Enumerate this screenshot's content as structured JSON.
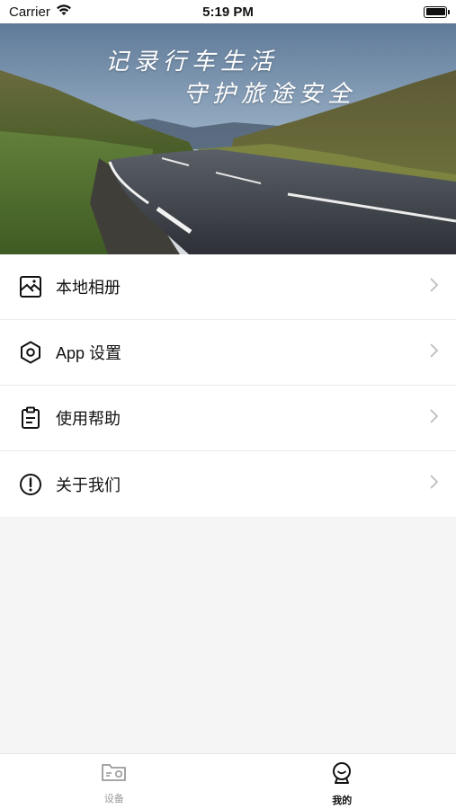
{
  "status_bar": {
    "carrier": "Carrier",
    "time": "5:19 PM",
    "icons": [
      "wifi-icon",
      "battery-icon"
    ]
  },
  "hero": {
    "line1": "记录行车生活",
    "line2": "守护旅途安全"
  },
  "menu": {
    "items": [
      {
        "label": "本地相册",
        "icon": "photo-album-icon"
      },
      {
        "label": "App 设置",
        "icon": "settings-hexagon-icon"
      },
      {
        "label": "使用帮助",
        "icon": "clipboard-icon"
      },
      {
        "label": "关于我们",
        "icon": "info-alert-icon"
      }
    ]
  },
  "tab_bar": {
    "tabs": [
      {
        "label": "设备",
        "icon": "device-folder-icon",
        "active": false
      },
      {
        "label": "我的",
        "icon": "profile-icon",
        "active": true
      }
    ]
  },
  "colors": {
    "active_tab": "#111111",
    "inactive_tab": "#9a9a9a",
    "background": "#f5f5f5"
  }
}
